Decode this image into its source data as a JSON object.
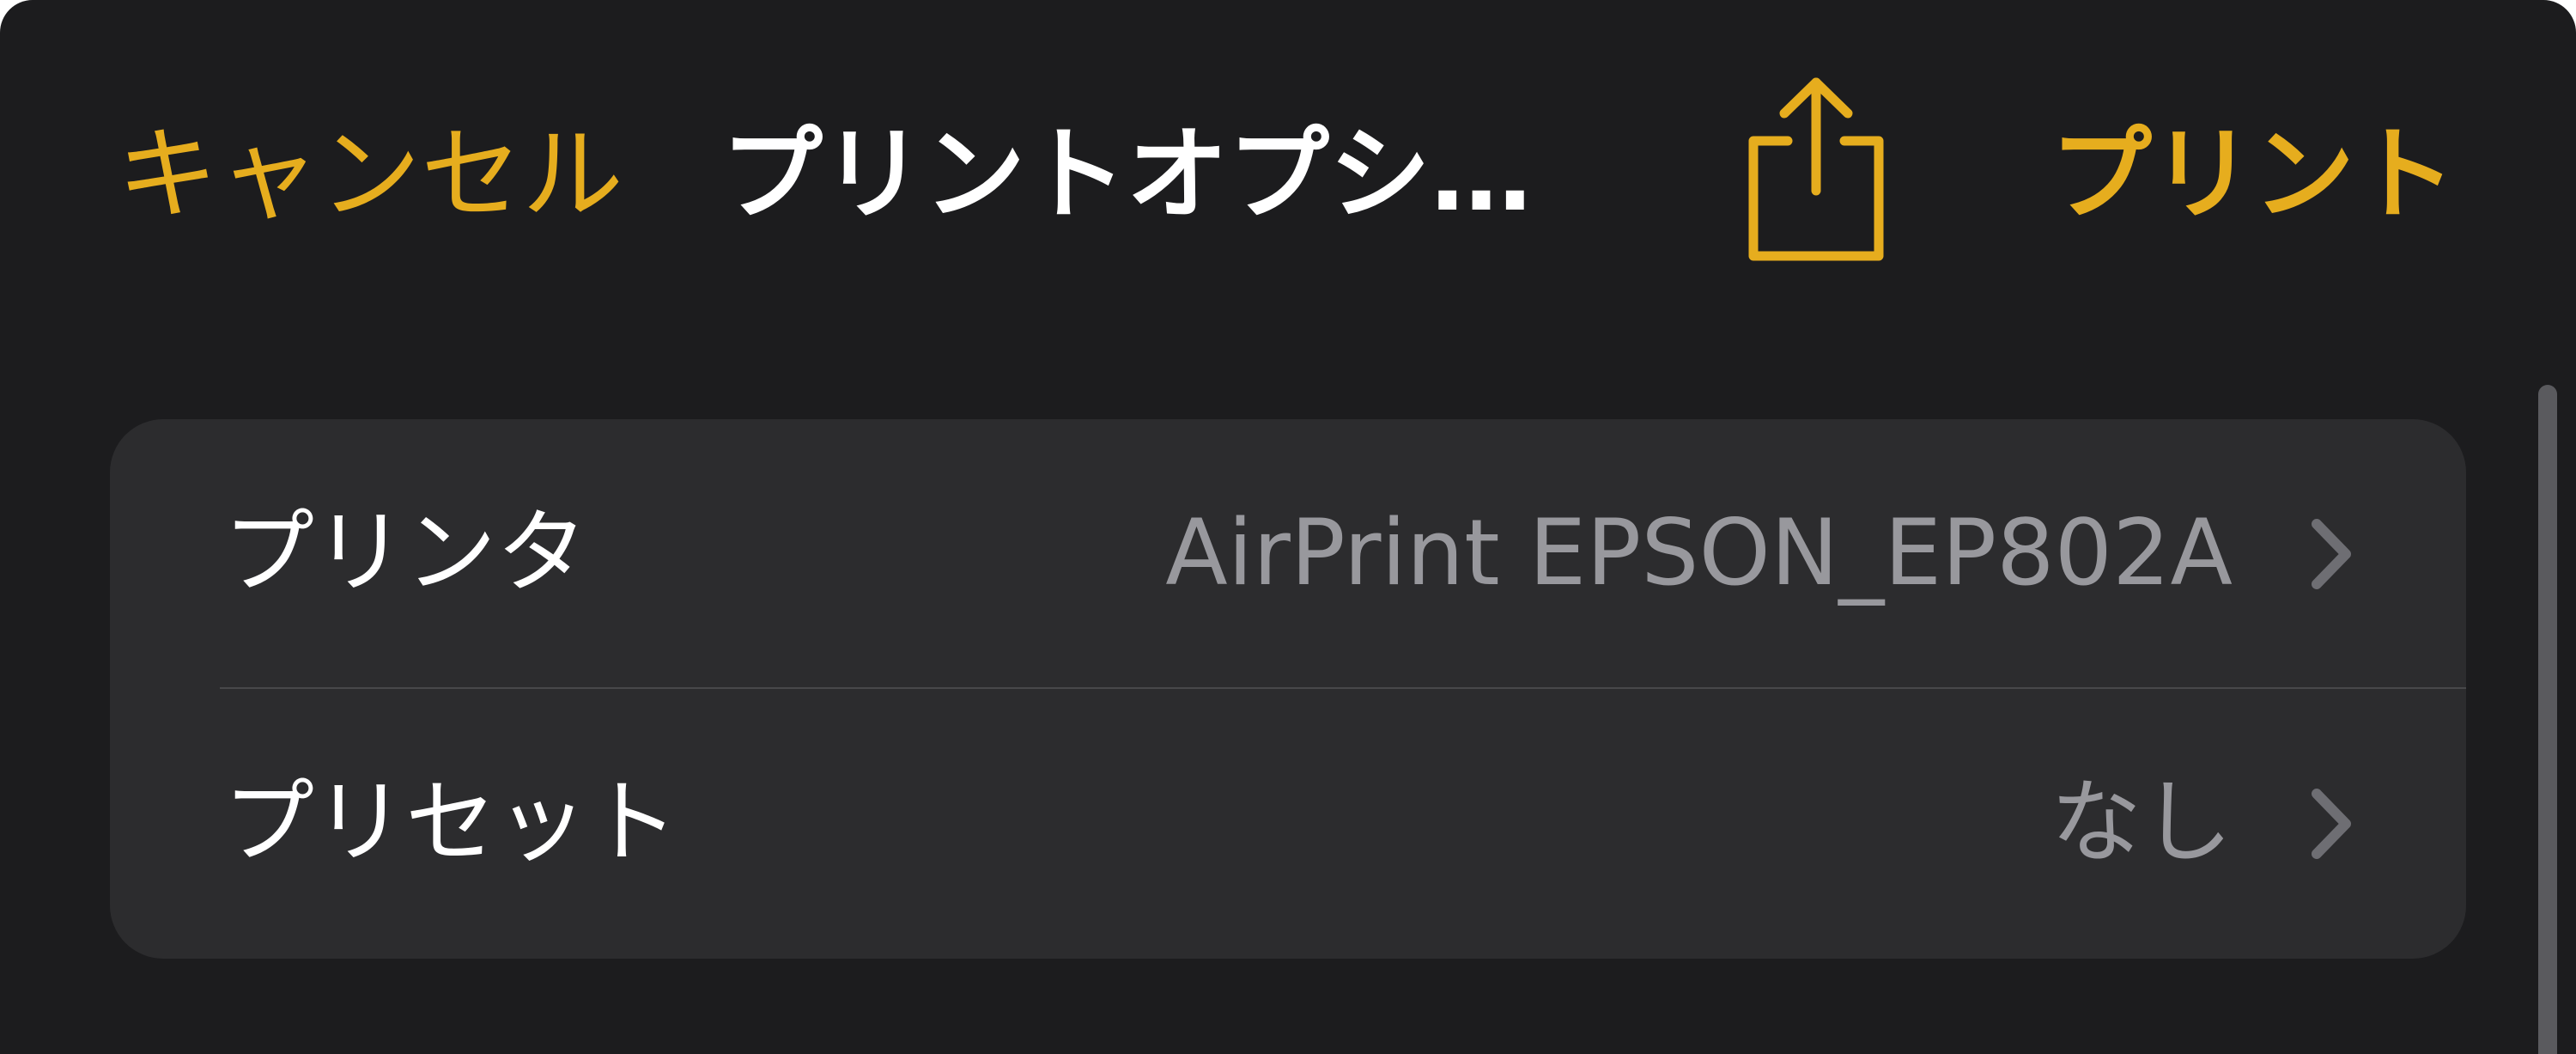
{
  "colors": {
    "sheet_background": "#1c1c1e",
    "group_background": "#2c2c2e",
    "accent": "#e6ad1e",
    "primary_text": "#ffffff",
    "secondary_text": "#98989d",
    "separator": "#48484a"
  },
  "nav": {
    "cancel_label": "キャンセル",
    "title": "プリントオプシ…",
    "share_icon": "share-icon",
    "print_label": "プリント"
  },
  "settings": {
    "rows": [
      {
        "label": "プリンタ",
        "value": "AirPrint EPSON_EP802A",
        "icon": "chevron-right-icon"
      },
      {
        "label": "プリセット",
        "value": "なし",
        "icon": "chevron-right-icon"
      }
    ]
  }
}
